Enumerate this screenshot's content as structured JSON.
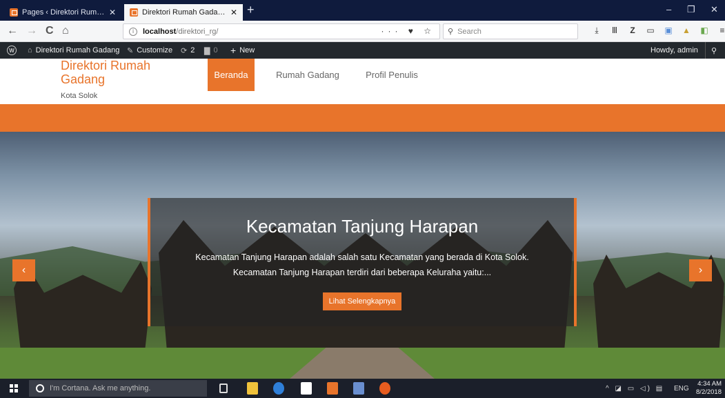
{
  "browser": {
    "tabs": [
      {
        "label": "Pages ‹ Direktori Rumah Gada",
        "close": "✕",
        "active": false
      },
      {
        "label": "Direktori Rumah Gadang – Kot",
        "close": "✕",
        "active": true
      }
    ],
    "new_tab": "+",
    "window_controls": {
      "minimize": "–",
      "maximize": "❐",
      "close": "✕"
    },
    "nav": {
      "back": "←",
      "forward": "→",
      "reload": "C",
      "home": "⌂"
    },
    "url": {
      "info": "i",
      "host": "localhost",
      "path": "/direktori_rg/",
      "actions": "··· ♥ ☆"
    },
    "search": {
      "icon": "⚲",
      "placeholder": "Search"
    },
    "toolbar_icons": [
      "download-icon",
      "library-icon",
      "zotero-icon",
      "sidebar-icon",
      "screenshot-icon",
      "extension-icon",
      "extension2-icon",
      "menu-icon"
    ],
    "toolbar_glyphs": [
      "⤓",
      "Ⅲ",
      "Z",
      "▭",
      "▣",
      "▲",
      "◧",
      "≡"
    ]
  },
  "admin_bar": {
    "wp_logo": "W",
    "site_name": "Direktori Rumah Gadang",
    "customize": "Customize",
    "updates_count": "2",
    "comments_count": "0",
    "new": "New",
    "howdy": "Howdy, admin",
    "search_icon": "⚲"
  },
  "site": {
    "title": "Direktori Rumah Gadang",
    "tagline": "Kota Solok",
    "menu": [
      "Beranda",
      "Rumah Gadang",
      "Profil Penulis"
    ],
    "active_menu": "Beranda",
    "accent": "#e8742b"
  },
  "slider": {
    "title": "Kecamatan Tanjung Harapan",
    "text_line1": "Kecamatan Tanjung Harapan adalah salah satu Kecamatan yang berada di Kota Solok.",
    "text_line2": "Kecamatan Tanjung Harapan terdiri dari beberapa Keluraha yaitu:...",
    "button": "Lihat Selengkapnya",
    "prev": "‹",
    "next": "›"
  },
  "taskbar": {
    "cortana": "I'm Cortana. Ask me anything.",
    "language": "ENG",
    "time": "4:34 AM",
    "date": "8/2/2018",
    "tray_glyphs": "^ ◪ ▭ ◁) ▤"
  }
}
